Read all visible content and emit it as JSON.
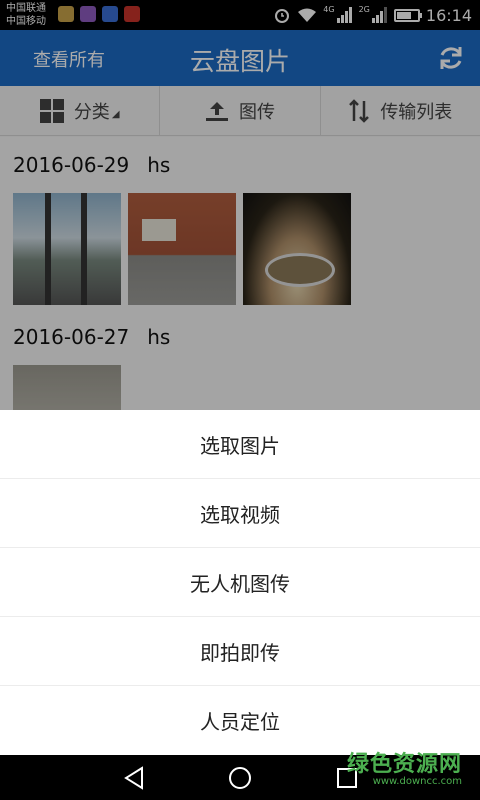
{
  "status_bar": {
    "carrier_1": "中国联通",
    "carrier_2": "中国移动",
    "net_4g": "4G",
    "net_2g": "2G",
    "time": "16:14"
  },
  "app_bar": {
    "left_action": "查看所有",
    "title": "云盘图片",
    "accent_color": "#1b6ac4"
  },
  "toolbar": {
    "category_label": "分类",
    "upload_label": "图传",
    "transfer_list_label": "传输列表"
  },
  "groups": [
    {
      "date": "2016-06-29",
      "user": "hs"
    },
    {
      "date": "2016-06-27",
      "user": "hs"
    }
  ],
  "sheet": {
    "items": [
      {
        "label": "选取图片"
      },
      {
        "label": "选取视频"
      },
      {
        "label": "无人机图传"
      },
      {
        "label": "即拍即传"
      },
      {
        "label": "人员定位"
      }
    ]
  },
  "watermark": {
    "main": "绿色资源网",
    "sub": "www.downcc.com"
  }
}
